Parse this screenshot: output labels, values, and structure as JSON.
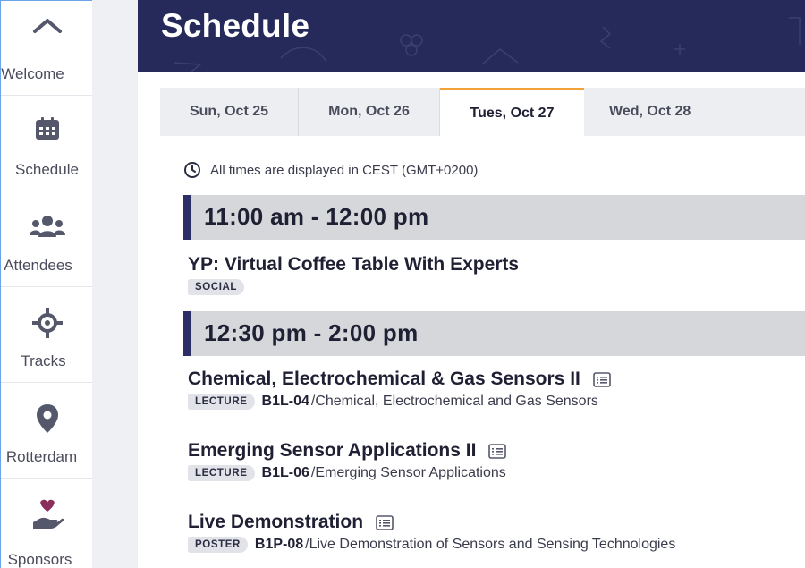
{
  "sidebar": {
    "items": [
      {
        "label": "Welcome",
        "icon": "home-icon"
      },
      {
        "label": "Schedule",
        "icon": "calendar-icon"
      },
      {
        "label": "Attendees",
        "icon": "people-icon"
      },
      {
        "label": "Tracks",
        "icon": "crosshair-icon"
      },
      {
        "label": "Rotterdam",
        "icon": "map-pin-icon"
      },
      {
        "label": "Sponsors",
        "icon": "hand-heart-icon"
      }
    ]
  },
  "header": {
    "title": "Schedule"
  },
  "tabs": [
    {
      "label": "Sun, Oct 25",
      "active": false
    },
    {
      "label": "Mon, Oct 26",
      "active": false
    },
    {
      "label": "Tues, Oct 27",
      "active": true
    },
    {
      "label": "Wed, Oct 28",
      "active": false
    }
  ],
  "timezone_note": "All times are displayed in CEST (GMT+0200)",
  "slots": [
    {
      "time": "11:00 am - 12:00 pm",
      "sessions": [
        {
          "title": "YP: Virtual Coffee Table With Experts",
          "badge": "SOCIAL",
          "code": "",
          "track": "",
          "has_list_icon": false
        }
      ]
    },
    {
      "time": "12:30 pm - 2:00 pm",
      "sessions": [
        {
          "title": "Chemical, Electrochemical & Gas Sensors II",
          "badge": "LECTURE",
          "code": "B1L-04",
          "track": "/Chemical, Electrochemical and Gas Sensors",
          "has_list_icon": true
        },
        {
          "title": "Emerging Sensor Applications II",
          "badge": "LECTURE",
          "code": "B1L-06",
          "track": "/Emerging Sensor Applications",
          "has_list_icon": true
        },
        {
          "title": "Live Demonstration",
          "badge": "POSTER",
          "code": "B1P-08",
          "track": "/Live Demonstration of Sensors and Sensing Technologies",
          "has_list_icon": true
        }
      ]
    }
  ],
  "colors": {
    "header_bg": "#252a5a",
    "active_tab_accent": "#f3a23a",
    "slot_bar": "#2b2f66",
    "slot_bg": "#d6d7db",
    "icon_gray": "#55586a"
  }
}
